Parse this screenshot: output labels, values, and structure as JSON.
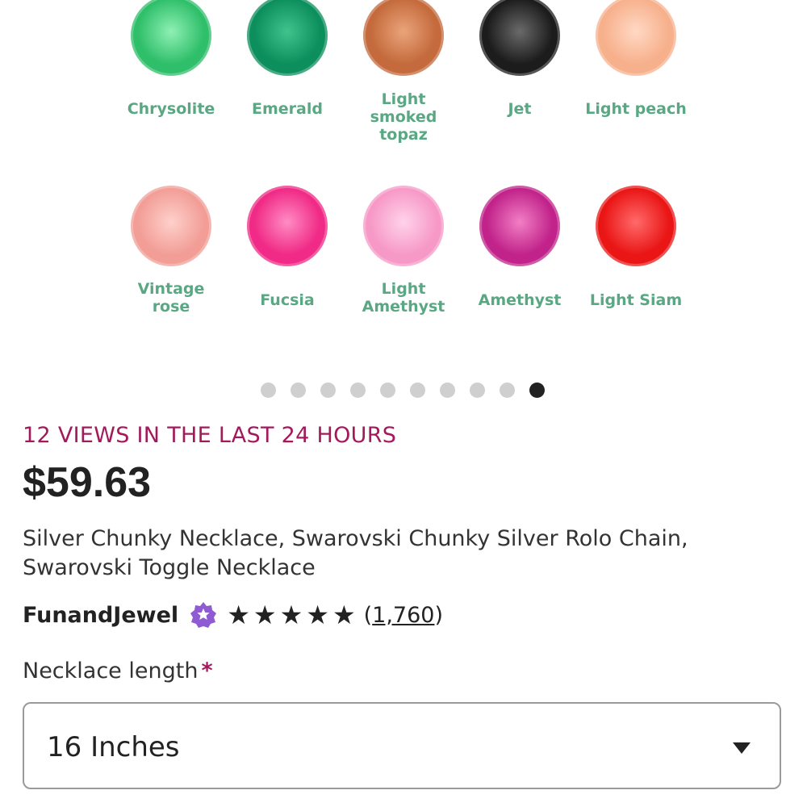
{
  "gallery": {
    "row1": [
      {
        "label_lines": [
          "Chrysolite"
        ],
        "color": "#2fbf6a",
        "highlight": "#8ff0b4"
      },
      {
        "label_lines": [
          "Emerald"
        ],
        "color": "#0c8f5c",
        "highlight": "#41c38d"
      },
      {
        "label_lines": [
          "Light smoked",
          "topaz"
        ],
        "color": "#c46a3c",
        "highlight": "#eaa47a"
      },
      {
        "label_lines": [
          "Jet"
        ],
        "color": "#1c1c1c",
        "highlight": "#6a6a6a"
      },
      {
        "label_lines": [
          "Light peach"
        ],
        "color": "#f7b08c",
        "highlight": "#ffd9c4"
      }
    ],
    "row2": [
      {
        "label_lines": [
          "Vintage",
          "rose"
        ],
        "color": "#f29e97",
        "highlight": "#ffd0cb"
      },
      {
        "label_lines": [
          "Fucsia"
        ],
        "color": "#f02a86",
        "highlight": "#ff8cc4"
      },
      {
        "label_lines": [
          "Light",
          "Amethyst"
        ],
        "color": "#f799c7",
        "highlight": "#ffd3ea"
      },
      {
        "label_lines": [
          "Amethyst"
        ],
        "color": "#c1238a",
        "highlight": "#f27fc5"
      },
      {
        "label_lines": [
          "Light Siam"
        ],
        "color": "#ea1616",
        "highlight": "#ff6a6a"
      }
    ],
    "carousel": {
      "count": 10,
      "active_index": 9
    }
  },
  "listing": {
    "views_text": "12 VIEWS IN THE LAST 24 HOURS",
    "price": "$59.63",
    "title_line1": "Silver Chunky Necklace, Swarovski Chunky Silver Rolo Chain,",
    "title_line2": "Swarovski Toggle Necklace",
    "shop_name": "FunandJewel",
    "rating_stars": 5,
    "review_count_prefix": "(",
    "review_count": "1,760",
    "review_count_suffix": ")"
  },
  "option": {
    "label": "Necklace length",
    "required_mark": "*",
    "selected_value": "16 Inches"
  },
  "colors": {
    "views_accent": "#a3195b",
    "gem_label": "#5aa783",
    "badge": "#8e5bd3"
  }
}
